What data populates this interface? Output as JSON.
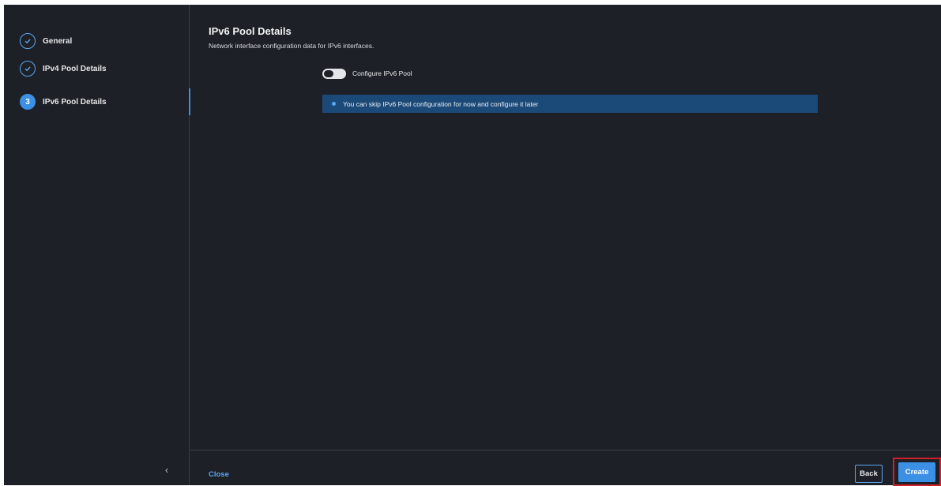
{
  "colors": {
    "background": "#1d2026",
    "accent": "#3b8fe4",
    "info_banner": "#1c4a78",
    "highlight_border": "#d21f2a"
  },
  "steps": [
    {
      "label": "General",
      "state": "completed",
      "icon": "check-icon"
    },
    {
      "label": "IPv4 Pool Details",
      "state": "completed",
      "icon": "check-icon"
    },
    {
      "label": "IPv6 Pool Details",
      "state": "current",
      "number": "3"
    }
  ],
  "sidebar": {
    "collapse_icon": "‹"
  },
  "main": {
    "title": "IPv6 Pool Details",
    "subtitle": "Network interface configuration data for IPv6 interfaces.",
    "toggle": {
      "label": "Configure IPv6 Pool",
      "on": false
    },
    "info": {
      "text": "You can skip IPv6 Pool configuration for now and configure it later",
      "icon": "info-dot-icon"
    }
  },
  "footer": {
    "close_label": "Close",
    "back_label": "Back",
    "create_label": "Create"
  }
}
